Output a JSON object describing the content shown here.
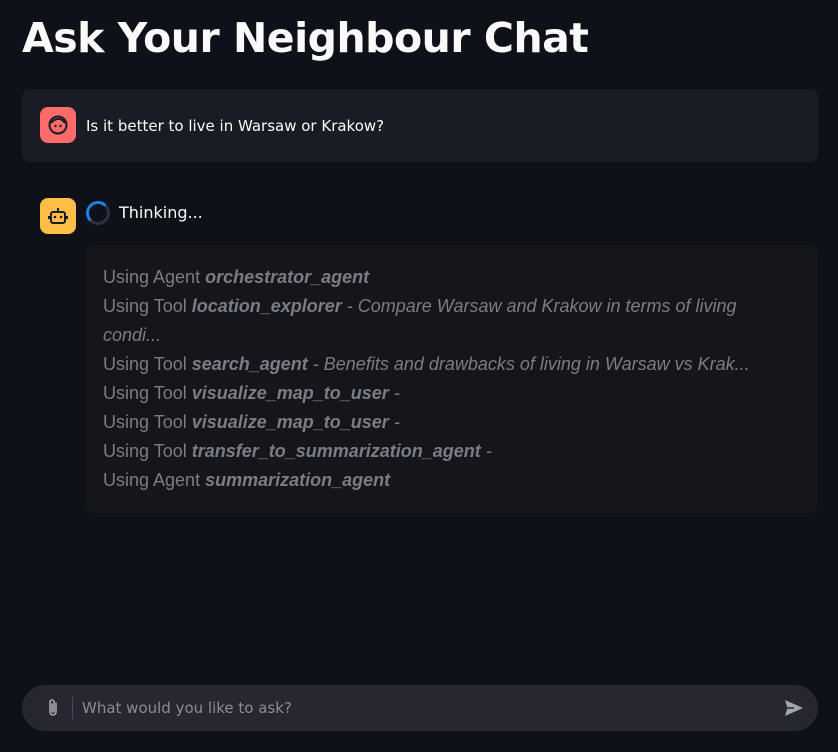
{
  "page": {
    "title": "Ask Your Neighbour Chat"
  },
  "messages": {
    "user": {
      "avatar_icon": "face-icon",
      "avatar_color": "#ff6b6b",
      "text": "Is it better to live in Warsaw or Krakow?"
    },
    "assistant": {
      "avatar_icon": "robot-icon",
      "avatar_color": "#ffbd45",
      "status": "Thinking...",
      "steps": [
        {
          "prefix": "Using Agent ",
          "name": "orchestrator_agent",
          "detail": ""
        },
        {
          "prefix": "Using Tool ",
          "name": "location_explorer",
          "detail": " - Compare Warsaw and Krakow in terms of living"
        },
        {
          "prefix": "",
          "name": "",
          "detail": "condi..."
        },
        {
          "prefix": "Using Tool ",
          "name": "search_agent",
          "detail": " - Benefits and drawbacks of living in Warsaw vs Krak..."
        },
        {
          "prefix": "Using Tool ",
          "name": "visualize_map_to_user",
          "detail": " -"
        },
        {
          "prefix": "Using Tool ",
          "name": "visualize_map_to_user",
          "detail": " -"
        },
        {
          "prefix": "Using Tool ",
          "name": "transfer_to_summarization_agent",
          "detail": " -"
        },
        {
          "prefix": "Using Agent ",
          "name": "summarization_agent",
          "detail": ""
        }
      ]
    }
  },
  "chat_input": {
    "placeholder": "What would you like to ask?",
    "value": "",
    "attach_icon": "paperclip-icon",
    "send_icon": "send-icon"
  },
  "colors": {
    "background": "#0e1117",
    "spinner_accent": "#1c83e1"
  }
}
